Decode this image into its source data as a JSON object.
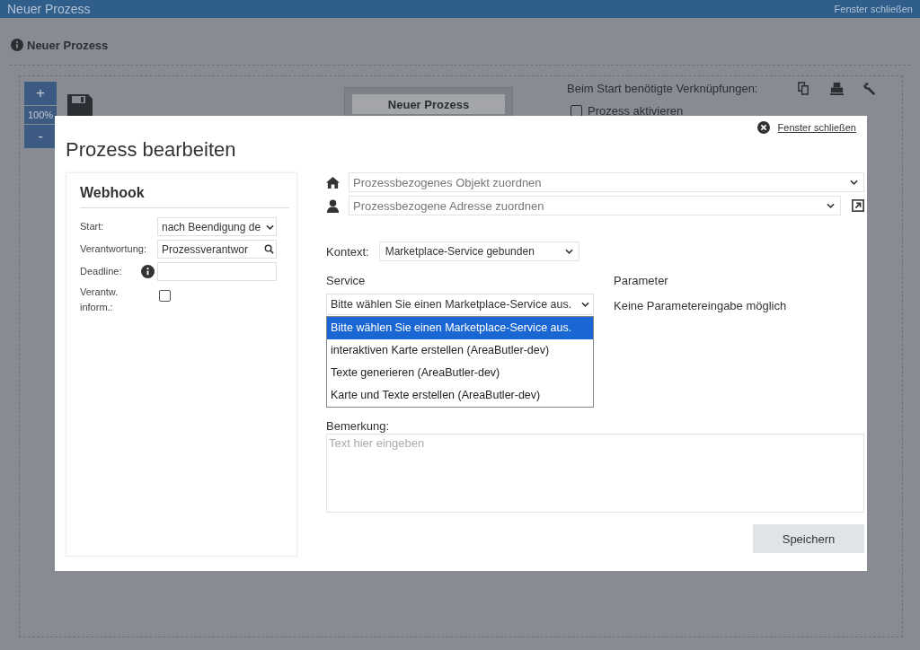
{
  "window": {
    "title": "Neuer Prozess",
    "close_link": "Fenster schließen"
  },
  "page": {
    "heading": "Neuer Prozess",
    "zoom": {
      "plus": "+",
      "level_label": "100%",
      "minus": "-"
    },
    "node_title": "Neuer Prozess",
    "links_label": "Beim Start benötigte Verknüpfungen:",
    "activate": {
      "label": "Prozess aktivieren",
      "checked": false
    }
  },
  "dialog": {
    "title": "Prozess bearbeiten",
    "close_link": "Fenster schließen",
    "step": {
      "title": "Webhook",
      "fields": [
        {
          "kind": "select",
          "label": "Start:",
          "value": "nach Beendigung de"
        },
        {
          "kind": "search",
          "label": "Verantwortung:",
          "value": "Prozessverantwor"
        },
        {
          "kind": "date",
          "label": "Deadline:",
          "info": true
        },
        {
          "kind": "checkbox",
          "label": "Verantw. inform.:",
          "checked": false
        }
      ]
    },
    "links": [
      {
        "kind": "object",
        "placeholder": "Prozessbezogenes Objekt zuordnen",
        "external": false
      },
      {
        "kind": "address",
        "placeholder": "Prozessbezogene Adresse zuordnen",
        "external": true
      }
    ],
    "context": {
      "label": "Kontext:",
      "value": "Marketplace-Service gebunden"
    },
    "service": {
      "label": "Service",
      "value": "Bitte wählen Sie einen Marketplace-Service aus.",
      "options": [
        {
          "label": "Bitte wählen Sie einen Marketplace-Service aus.",
          "selected": true
        },
        {
          "label": "interaktiven Karte erstellen (AreaButler-dev)",
          "selected": false
        },
        {
          "label": "Texte generieren (AreaButler-dev)",
          "selected": false
        },
        {
          "label": "Karte und Texte erstellen (AreaButler-dev)",
          "selected": false
        }
      ]
    },
    "parameter": {
      "label": "Parameter",
      "text": "Keine Parametereingabe möglich"
    },
    "remark": {
      "label": "Bemerkung:",
      "placeholder": "Text hier eingeben"
    },
    "save_button": "Speichern"
  }
}
